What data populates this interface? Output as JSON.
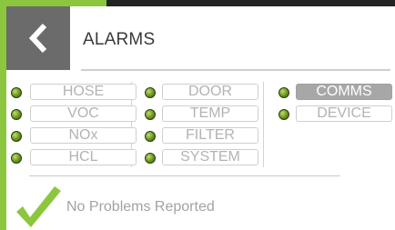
{
  "colors": {
    "accent": "#8cc63f",
    "dark_header": "#232323",
    "back_button_bg": "#6b6b6b",
    "led_green": "#6d9a22",
    "active_tag_bg": "#a7a7a7",
    "check_green": "#8cc63f"
  },
  "header": {
    "title": "ALARMS",
    "back_icon": "chevron-left-icon"
  },
  "alarm_columns": [
    {
      "items": [
        {
          "label": "HOSE",
          "active": false
        },
        {
          "label": "VOC",
          "active": false
        },
        {
          "label": "NOx",
          "active": false
        },
        {
          "label": "HCL",
          "active": false
        }
      ]
    },
    {
      "items": [
        {
          "label": "DOOR",
          "active": false
        },
        {
          "label": "TEMP",
          "active": false
        },
        {
          "label": "FILTER",
          "active": false
        },
        {
          "label": "SYSTEM",
          "active": false
        }
      ]
    },
    {
      "items": [
        {
          "label": "COMMS",
          "active": true
        },
        {
          "label": "DEVICE",
          "active": false
        }
      ]
    }
  ],
  "status": {
    "icon": "checkmark-icon",
    "text": "No Problems Reported"
  }
}
